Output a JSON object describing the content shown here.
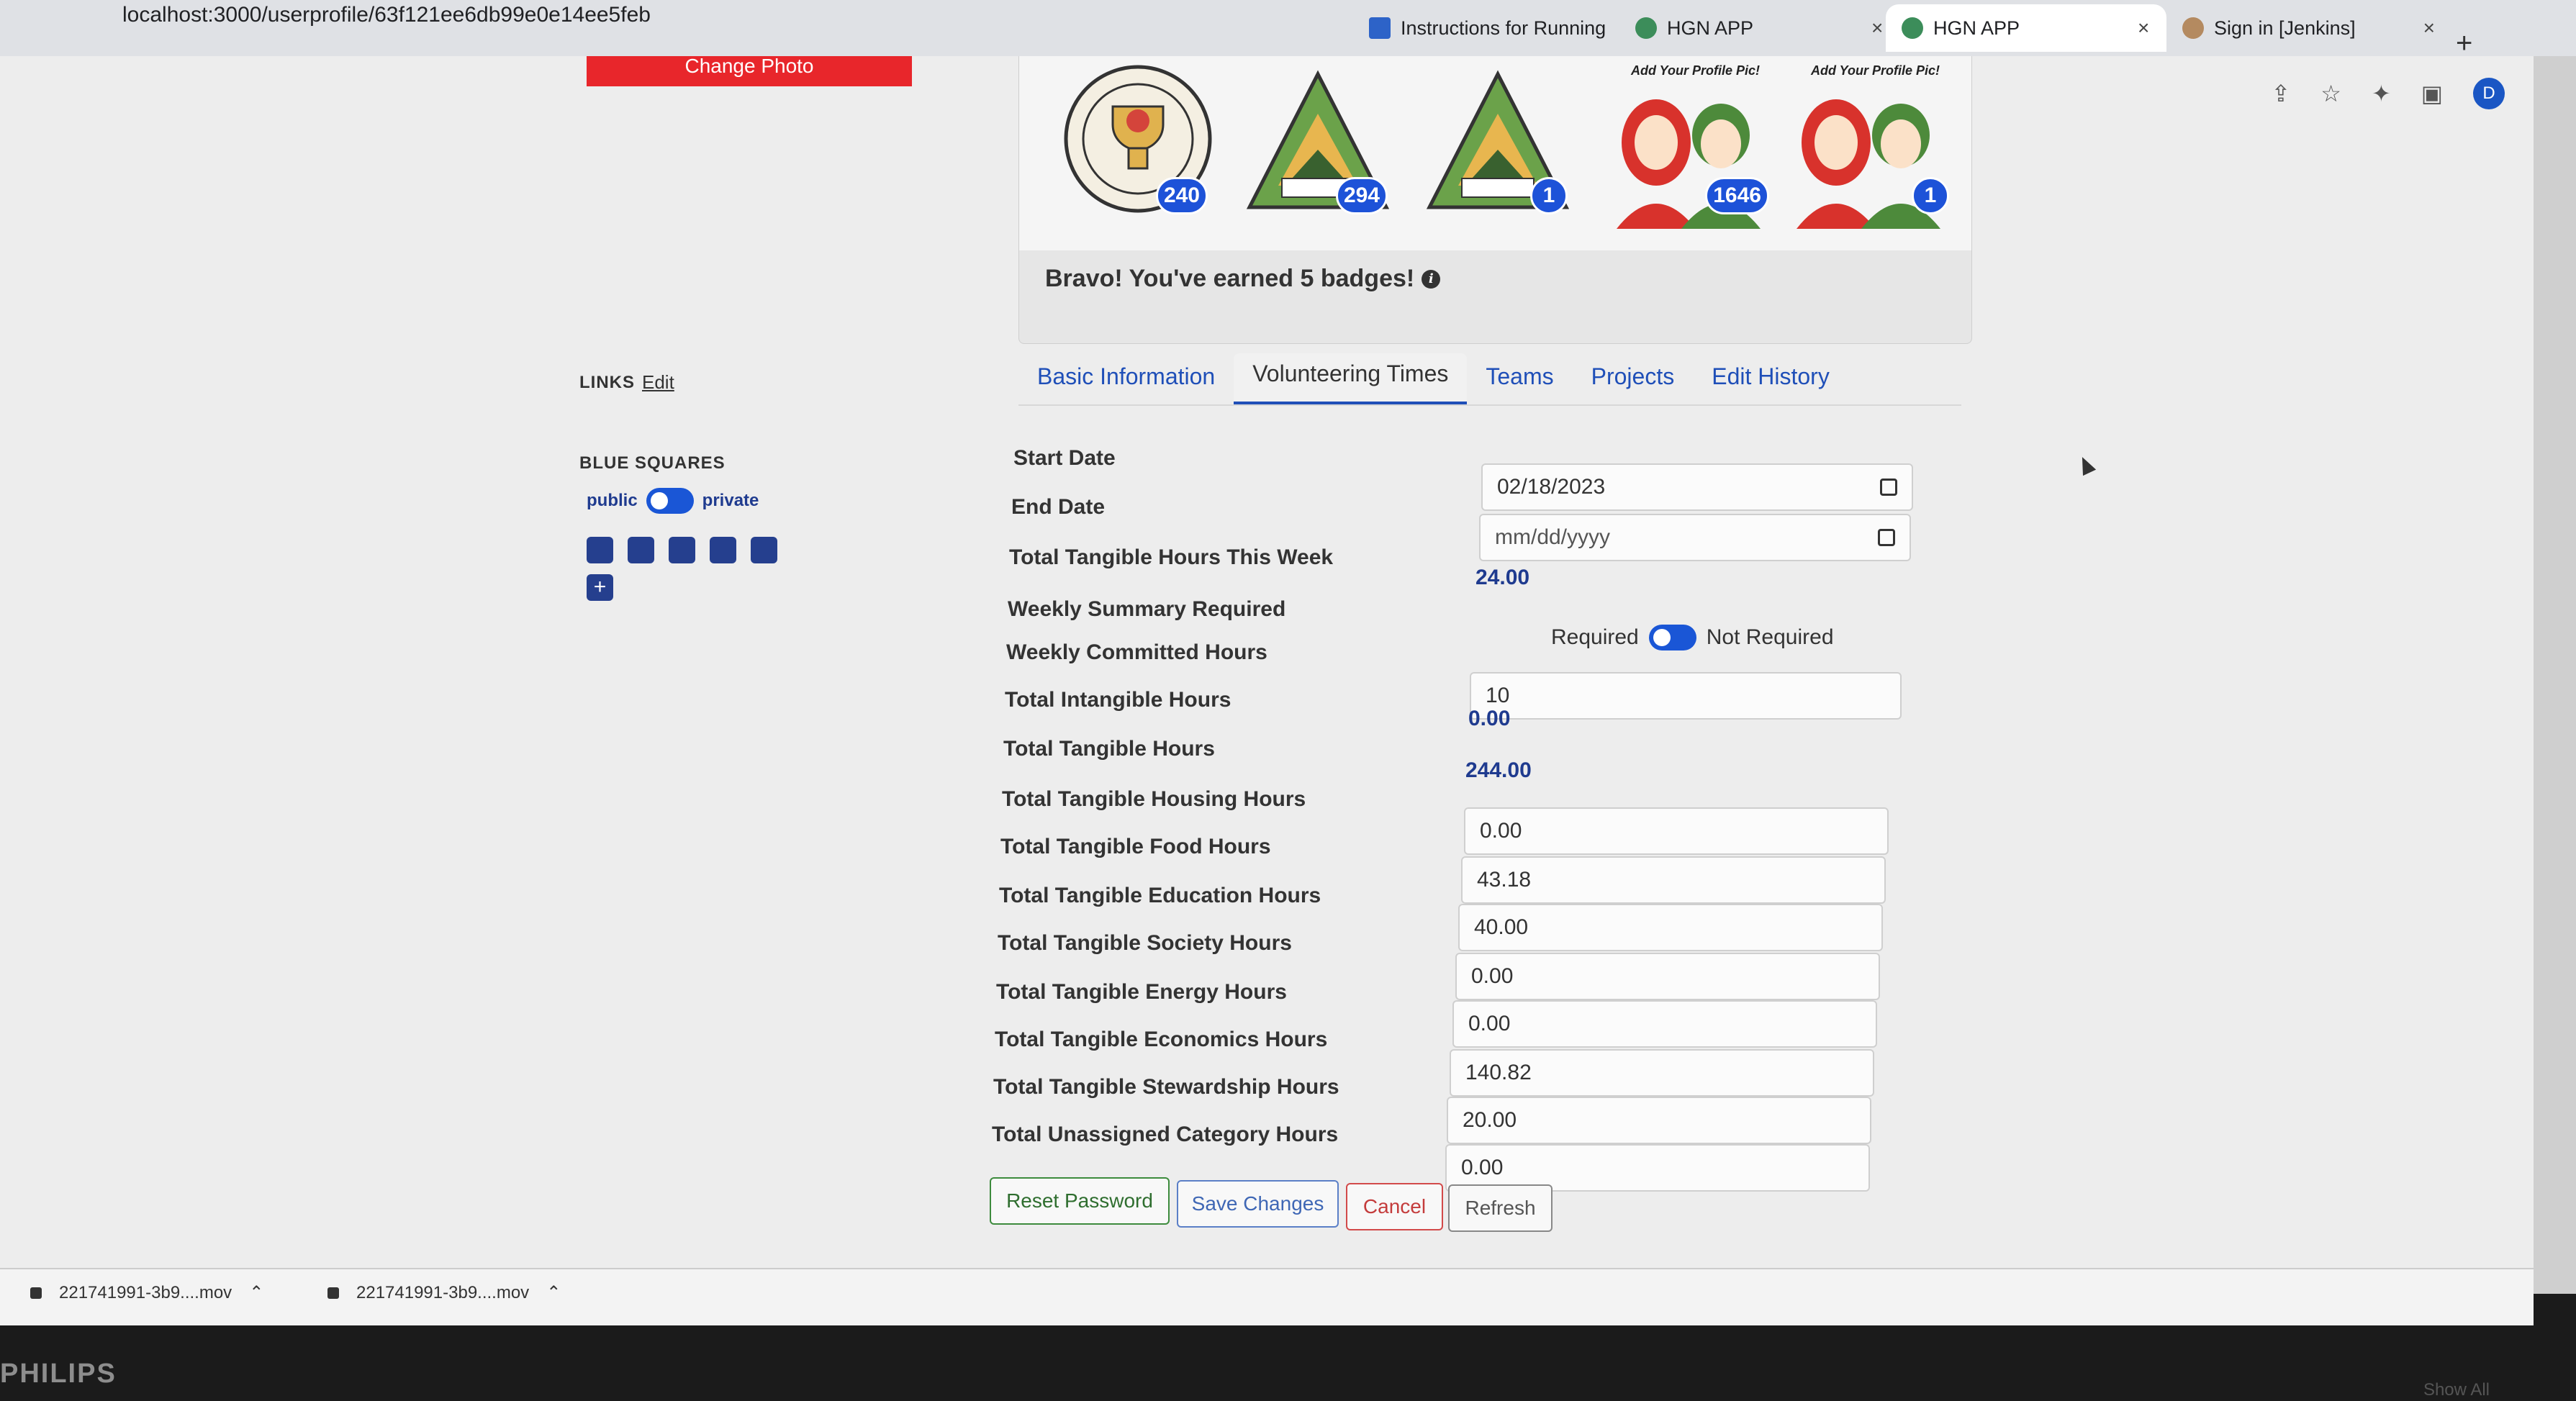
{
  "browser": {
    "url": "localhost:3000/userprofile/63f121ee6db99e0e14ee5feb",
    "tabs": [
      {
        "label": "Instructions for Running",
        "icon": "doc-icon"
      },
      {
        "label": "HGN APP",
        "icon": "globe-icon"
      },
      {
        "label": "HGN APP",
        "icon": "globe-icon"
      },
      {
        "label": "Sign in [Jenkins]",
        "icon": "jenkins-icon"
      }
    ],
    "new_tab": "+",
    "profile_initial": "D"
  },
  "profile": {
    "change_photo_label": "Change Photo",
    "links_label": "LINKS",
    "links_edit": "Edit",
    "blue_squares_label": "BLUE SQUARES",
    "public_label": "public",
    "private_label": "private",
    "blue_square_count": 5,
    "add_label": "+"
  },
  "badges": {
    "items": [
      {
        "name": "tangible-hours-trophy-badge",
        "count": "240"
      },
      {
        "name": "100-hours-badge",
        "count": "294"
      },
      {
        "name": "100-hours-badge-2",
        "count": "1"
      },
      {
        "name": "add-profile-pic-badge",
        "caption": "Add Your Profile Pic!",
        "count": "1646"
      },
      {
        "name": "add-profile-pic-badge-2",
        "caption": "Add Your Profile Pic!",
        "count": "1"
      }
    ],
    "message": "Bravo! You've earned 5 badges!"
  },
  "tabs": [
    "Basic Information",
    "Volunteering Times",
    "Teams",
    "Projects",
    "Edit History"
  ],
  "active_tab": "Volunteering Times",
  "form": {
    "start_date_label": "Start Date",
    "start_date_value": "02/18/2023",
    "end_date_label": "End Date",
    "end_date_placeholder": "mm/dd/yyyy",
    "tangible_week_label": "Total Tangible Hours This Week",
    "tangible_week_value": "24.00",
    "weekly_summary_label": "Weekly Summary Required",
    "required_label": "Required",
    "not_required_label": "Not Required",
    "weekly_committed_label": "Weekly Committed Hours",
    "weekly_committed_value": "10",
    "intangible_label": "Total Intangible Hours",
    "intangible_value": "0.00",
    "tangible_label": "Total Tangible Hours",
    "tangible_value": "244.00",
    "categories": [
      {
        "label": "Total Tangible Housing Hours",
        "value": "0.00"
      },
      {
        "label": "Total Tangible Food Hours",
        "value": "43.18"
      },
      {
        "label": "Total Tangible Education Hours",
        "value": "40.00"
      },
      {
        "label": "Total Tangible Society Hours",
        "value": "0.00"
      },
      {
        "label": "Total Tangible Energy Hours",
        "value": "0.00"
      },
      {
        "label": "Total Tangible Economics Hours",
        "value": "140.82"
      },
      {
        "label": "Total Tangible Stewardship Hours",
        "value": "20.00"
      },
      {
        "label": "Total Unassigned Category Hours",
        "value": "0.00"
      }
    ]
  },
  "buttons": {
    "reset_password": "Reset Password",
    "save_changes": "Save Changes",
    "cancel": "Cancel",
    "refresh": "Refresh"
  },
  "downloads": [
    {
      "name": "221741991-3b9....mov"
    },
    {
      "name": "221741991-3b9....mov"
    }
  ],
  "show_all": "Show All",
  "monitor_brand": "PHILIPS"
}
